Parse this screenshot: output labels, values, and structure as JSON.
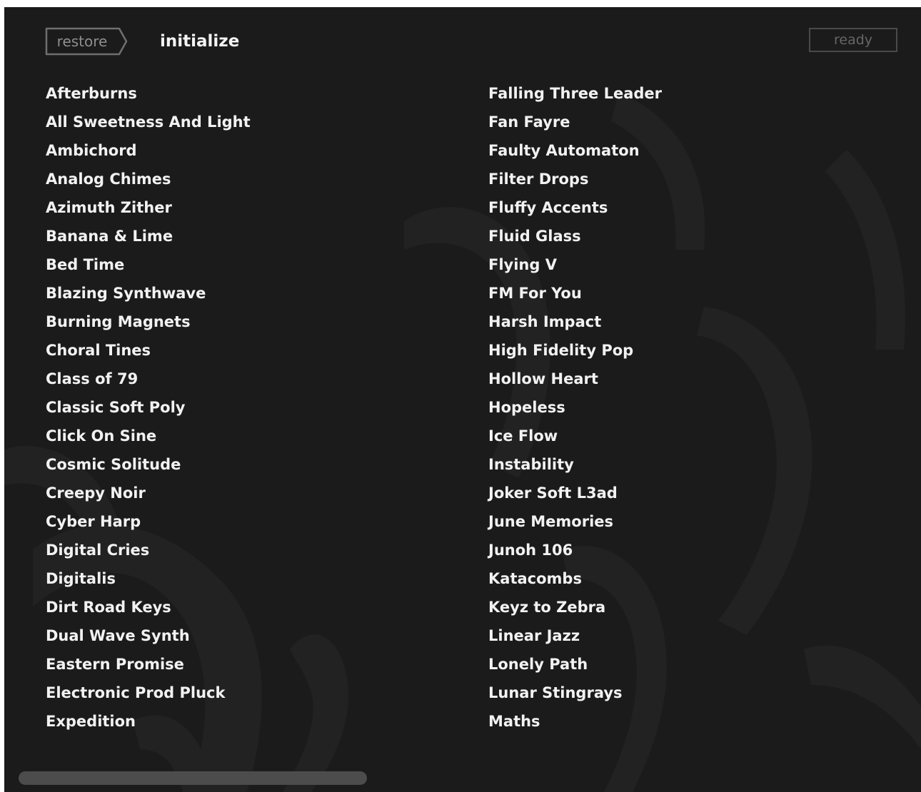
{
  "toolbar": {
    "restore_label": "restore",
    "initialize_label": "initialize",
    "status": "ready"
  },
  "presets": {
    "left": [
      "Afterburns",
      "All Sweetness And Light",
      "Ambichord",
      "Analog Chimes",
      "Azimuth Zither",
      "Banana & Lime",
      "Bed Time",
      "Blazing Synthwave",
      "Burning Magnets",
      "Choral Tines",
      "Class of 79",
      "Classic Soft Poly",
      "Click On Sine",
      "Cosmic Solitude",
      "Creepy Noir",
      "Cyber Harp",
      "Digital Cries",
      "Digitalis",
      "Dirt Road Keys",
      "Dual Wave Synth",
      "Eastern Promise",
      "Electronic Prod Pluck",
      "Expedition"
    ],
    "right": [
      "Falling Three Leader",
      "Fan Fayre",
      "Faulty Automaton",
      "Filter Drops",
      "Fluffy Accents",
      "Fluid Glass",
      "Flying V",
      "FM For You",
      "Harsh Impact",
      "High Fidelity Pop",
      "Hollow Heart",
      "Hopeless",
      "Ice Flow",
      "Instability",
      "Joker Soft L3ad",
      "June Memories",
      "Junoh 106",
      "Katacombs",
      "Keyz to Zebra",
      "Linear Jazz",
      "Lonely Path",
      "Lunar Stingrays",
      "Maths"
    ]
  },
  "colors": {
    "background": "#1b1b1b",
    "text": "#f2f2f2",
    "muted": "#8e8e8e",
    "scrollbar": "#4c4c4c"
  },
  "icons": {
    "restore_shape": "arrow-tag-outline"
  }
}
